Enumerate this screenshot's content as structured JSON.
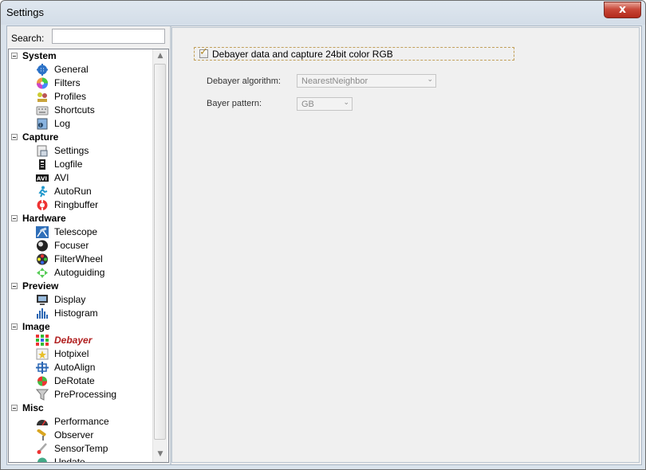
{
  "window": {
    "title": "Settings",
    "close_glyph": "x"
  },
  "search": {
    "label": "Search:",
    "value": "",
    "placeholder": ""
  },
  "tree": {
    "groups": [
      {
        "label": "System",
        "items": [
          {
            "label": "General",
            "icon": "gear-icon"
          },
          {
            "label": "Filters",
            "icon": "color-wheel-icon"
          },
          {
            "label": "Profiles",
            "icon": "profiles-icon"
          },
          {
            "label": "Shortcuts",
            "icon": "keyboard-icon"
          },
          {
            "label": "Log",
            "icon": "log-icon"
          }
        ]
      },
      {
        "label": "Capture",
        "items": [
          {
            "label": "Settings",
            "icon": "capture-settings-icon"
          },
          {
            "label": "Logfile",
            "icon": "logfile-icon"
          },
          {
            "label": "AVI",
            "icon": "avi-icon"
          },
          {
            "label": "AutoRun",
            "icon": "autorun-icon"
          },
          {
            "label": "Ringbuffer",
            "icon": "lifebuoy-icon"
          }
        ]
      },
      {
        "label": "Hardware",
        "items": [
          {
            "label": "Telescope",
            "icon": "telescope-icon"
          },
          {
            "label": "Focuser",
            "icon": "focuser-icon"
          },
          {
            "label": "FilterWheel",
            "icon": "filterwheel-icon"
          },
          {
            "label": "Autoguiding",
            "icon": "autoguiding-icon"
          }
        ]
      },
      {
        "label": "Preview",
        "items": [
          {
            "label": "Display",
            "icon": "monitor-icon"
          },
          {
            "label": "Histogram",
            "icon": "histogram-icon"
          }
        ]
      },
      {
        "label": "Image",
        "items": [
          {
            "label": "Debayer",
            "icon": "debayer-grid-icon",
            "selected": true
          },
          {
            "label": "Hotpixel",
            "icon": "hotpixel-icon"
          },
          {
            "label": "AutoAlign",
            "icon": "autoalign-icon"
          },
          {
            "label": "DeRotate",
            "icon": "derotate-icon"
          },
          {
            "label": "PreProcessing",
            "icon": "funnel-icon"
          }
        ]
      },
      {
        "label": "Misc",
        "items": [
          {
            "label": "Performance",
            "icon": "speedometer-icon"
          },
          {
            "label": "Observer",
            "icon": "observer-icon"
          },
          {
            "label": "SensorTemp",
            "icon": "thermometer-icon"
          },
          {
            "label": "Update",
            "icon": "update-icon"
          }
        ]
      }
    ]
  },
  "debayer": {
    "checkbox_label": "Debayer data and capture 24bit color RGB",
    "checked": true,
    "algorithm_label": "Debayer algorithm:",
    "algorithm_value": "NearestNeighbor",
    "pattern_label": "Bayer pattern:",
    "pattern_value": "GB"
  },
  "colors": {
    "selected_item": "#b01d1d",
    "close_button": "#c9493a",
    "panel_bg": "#f0f0f0"
  }
}
